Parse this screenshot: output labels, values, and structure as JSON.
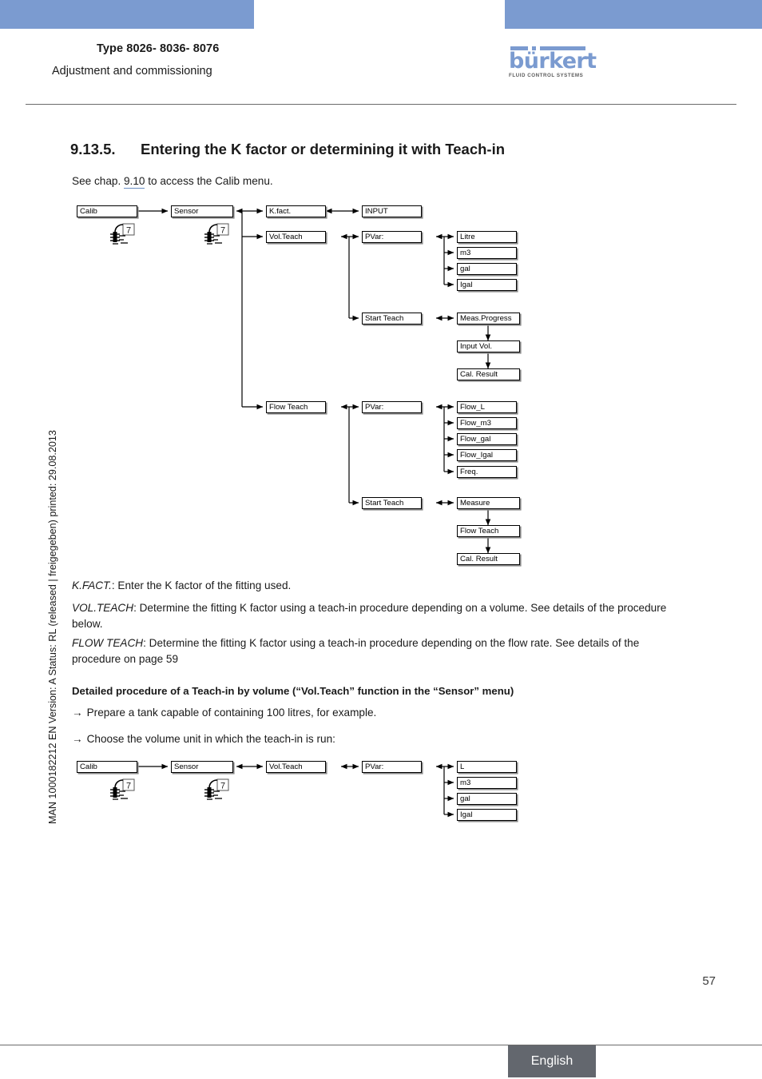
{
  "header": {
    "title": "Type 8026- 8036- 8076",
    "subtitle": "Adjustment and commissioning",
    "logo_word": "bürkert",
    "logo_tagline": "FLUID CONTROL SYSTEMS",
    "accent_color": "#7b9bd0"
  },
  "sidebar": {
    "text": "MAN 1000182212  EN  Version: A  Status: RL (released | freigegeben)  printed: 29.08.2013"
  },
  "section": {
    "number": "9.13.5.",
    "title": "Entering the K factor or determining it with Teach-in",
    "intro_before": "See chap. ",
    "intro_link": "9.10",
    "intro_after": " to access the Calib menu."
  },
  "paragraphs": [
    {
      "term": "K.FACT.",
      "rest": ": Enter the K factor of the fitting used."
    },
    {
      "term": "VOL.TEACH",
      "rest": ": Determine the fitting K factor using a teach-in procedure depending on a volume. See details of the procedure below."
    },
    {
      "term": "FLOW TEACH",
      "rest": ": Determine the fitting K factor using a teach-in procedure depending on the flow rate. See details of the procedure on page 59"
    }
  ],
  "subhead": "Detailed procedure of a Teach-in by volume (“Vol.Teach” function in the “Sensor” menu)",
  "bullets": [
    "Prepare a tank capable of containing 100 litres, for example.",
    "Choose the volume unit in which the teach-in is run:"
  ],
  "bullet_arrow": "→",
  "diagram_main": {
    "nodes": {
      "calib": "Calib",
      "sensor": "Sensor",
      "kfact": "K.fact.",
      "input": "INPUT",
      "volteach": "Vol.Teach",
      "pvar_vol": "PVar:",
      "unit_litre": "Litre",
      "unit_m3": "m3",
      "unit_gal": "gal",
      "unit_igal": "Igal",
      "start_teach_vol": "Start Teach",
      "meas_progress": "Meas.Progress",
      "input_vol": "Input Vol.",
      "cal_result_vol": "Cal. Result",
      "flowteach": "Flow Teach",
      "pvar_flow": "PVar:",
      "flow_l": "Flow_L",
      "flow_m3": "Flow_m3",
      "flow_gal": "Flow_gal",
      "flow_igal": "Flow_Igal",
      "freq": "Freq.",
      "start_teach_flow": "Start Teach",
      "measure": "Measure",
      "flow_teach_res": "Flow Teach",
      "cal_result_flow": "Cal. Result"
    }
  },
  "diagram_bottom": {
    "nodes": {
      "calib": "Calib",
      "sensor": "Sensor",
      "volteach": "Vol.Teach",
      "pvar": "PVar:",
      "unit_l": "L",
      "unit_m3": "m3",
      "unit_gal": "gal",
      "unit_igal": "Igal"
    }
  },
  "footer": {
    "page_number": "57",
    "language": "English"
  }
}
